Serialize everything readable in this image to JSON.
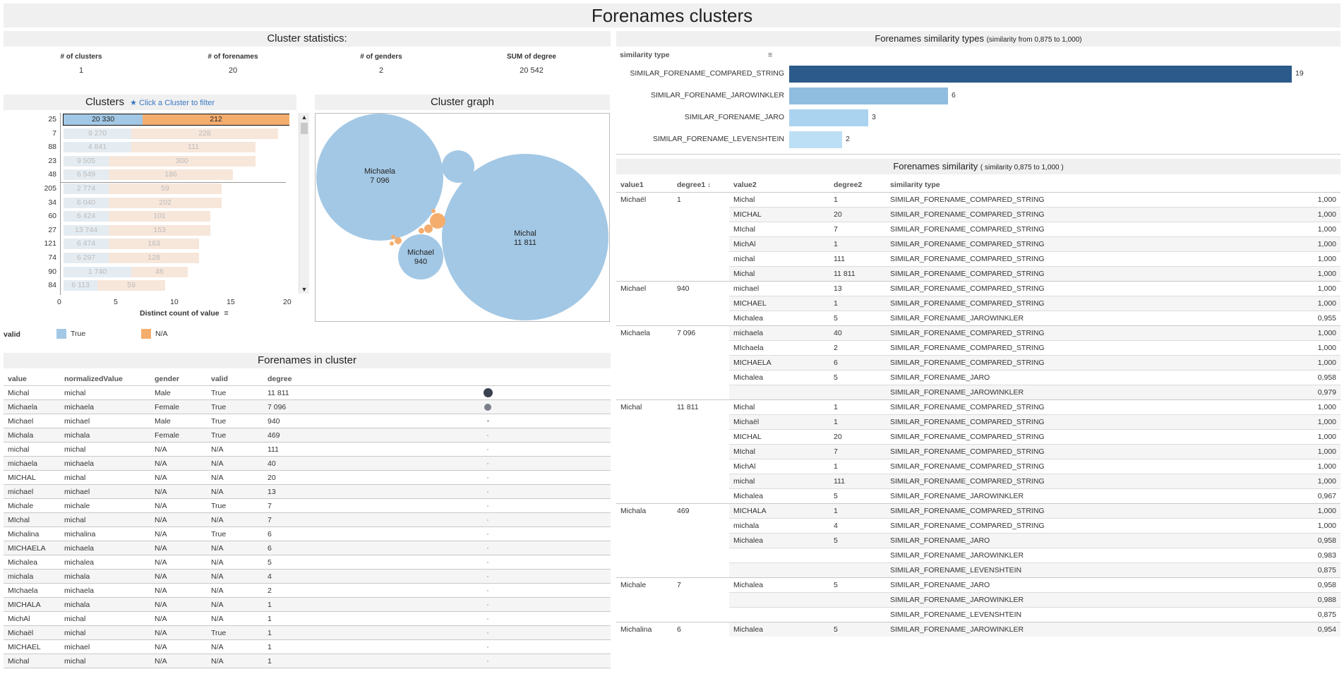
{
  "title": "Forenames clusters",
  "stats": {
    "title": "Cluster statistics:",
    "items": [
      {
        "label": "# of clusters",
        "value": "1"
      },
      {
        "label": "# of forenames",
        "value": "20"
      },
      {
        "label": "# of genders",
        "value": "2"
      },
      {
        "label": "SUM of degree",
        "value": "20 542"
      }
    ]
  },
  "clusters": {
    "title": "Clusters",
    "hint": "★ Click a Cluster to filter",
    "axis_label": "Distinct count of value",
    "ticks": [
      "0",
      "5",
      "10",
      "15",
      "20"
    ],
    "legend_title": "valid",
    "legend": [
      {
        "label": "True",
        "color": "#a3c8e5"
      },
      {
        "label": "N/A",
        "color": "#f5ad6e"
      }
    ],
    "rows": [
      {
        "id": "25",
        "true": 7,
        "na": 13,
        "true_label": "20 330",
        "na_label": "212",
        "selected": true
      },
      {
        "id": "7",
        "true": 6,
        "na": 13,
        "true_label": "9 270",
        "na_label": "228"
      },
      {
        "id": "88",
        "true": 6,
        "na": 11,
        "true_label": "4 841",
        "na_label": "111"
      },
      {
        "id": "23",
        "true": 4,
        "na": 13,
        "true_label": "9 505",
        "na_label": "300"
      },
      {
        "id": "48",
        "true": 4,
        "na": 11,
        "true_label": "6 549",
        "na_label": "186"
      },
      {
        "id": "205",
        "true": 4,
        "na": 10,
        "true_label": "2 774",
        "na_label": "59"
      },
      {
        "id": "34",
        "true": 4,
        "na": 10,
        "true_label": "6 040",
        "na_label": "202"
      },
      {
        "id": "60",
        "true": 4,
        "na": 9,
        "true_label": "6 424",
        "na_label": "101"
      },
      {
        "id": "27",
        "true": 4,
        "na": 9,
        "true_label": "13 744",
        "na_label": "153"
      },
      {
        "id": "121",
        "true": 4,
        "na": 8,
        "true_label": "6 474",
        "na_label": "163"
      },
      {
        "id": "74",
        "true": 4,
        "na": 8,
        "true_label": "6 297",
        "na_label": "128"
      },
      {
        "id": "90",
        "true": 6,
        "na": 5,
        "true_label": "1 740",
        "na_label": "46"
      },
      {
        "id": "84",
        "true": 3,
        "na": 6,
        "true_label": "6 113",
        "na_label": "59"
      }
    ]
  },
  "graph": {
    "title": "Cluster graph",
    "bubbles": [
      {
        "name": "Michaela",
        "degree": "7 096"
      },
      {
        "name": "Michal",
        "degree": "11 811"
      },
      {
        "name": "Michael",
        "degree": "940"
      }
    ]
  },
  "forenames": {
    "title": "Forenames in cluster",
    "columns": [
      "value",
      "normalizedValue",
      "gender",
      "valid",
      "degree"
    ],
    "rows": [
      [
        "Michal",
        "michal",
        "Male",
        "True",
        "11 811"
      ],
      [
        "Michaela",
        "michaela",
        "Female",
        "True",
        "7 096"
      ],
      [
        "Michael",
        "michael",
        "Male",
        "True",
        "940"
      ],
      [
        "Michala",
        "michala",
        "Female",
        "True",
        "469"
      ],
      [
        "michal",
        "michal",
        "N/A",
        "N/A",
        "111"
      ],
      [
        "michaela",
        "michaela",
        "N/A",
        "N/A",
        "40"
      ],
      [
        "MICHAL",
        "michal",
        "N/A",
        "N/A",
        "20"
      ],
      [
        "michael",
        "michael",
        "N/A",
        "N/A",
        "13"
      ],
      [
        "Michale",
        "michale",
        "N/A",
        "True",
        "7"
      ],
      [
        "MIchal",
        "michal",
        "N/A",
        "N/A",
        "7"
      ],
      [
        "Michalina",
        "michalina",
        "N/A",
        "True",
        "6"
      ],
      [
        "MICHAELA",
        "michaela",
        "N/A",
        "N/A",
        "6"
      ],
      [
        "Michalea",
        "michalea",
        "N/A",
        "N/A",
        "5"
      ],
      [
        "michala",
        "michala",
        "N/A",
        "N/A",
        "4"
      ],
      [
        "MIchaela",
        "michaela",
        "N/A",
        "N/A",
        "2"
      ],
      [
        "MICHALA",
        "michala",
        "N/A",
        "N/A",
        "1"
      ],
      [
        "MichAl",
        "michal",
        "N/A",
        "N/A",
        "1"
      ],
      [
        "Michaël",
        "michal",
        "N/A",
        "True",
        "1"
      ],
      [
        "MICHAEL",
        "michael",
        "N/A",
        "N/A",
        "1"
      ],
      [
        "Michal",
        "michal",
        "N/A",
        "N/A",
        "1"
      ]
    ]
  },
  "simtypes": {
    "title": "Forenames similarity types",
    "subtitle": "(similarity from 0,875 to 1,000)",
    "column": "similarity type",
    "rows": [
      {
        "label": "SIMILAR_FORENAME_COMPARED_STRING",
        "value": 19,
        "color": "#2c5a8a"
      },
      {
        "label": "SIMILAR_FORENAME_JAROWINKLER",
        "value": 6,
        "color": "#8fbde0"
      },
      {
        "label": "SIMILAR_FORENAME_JARO",
        "value": 3,
        "color": "#aad3ef"
      },
      {
        "label": "SIMILAR_FORENAME_LEVENSHTEIN",
        "value": 2,
        "color": "#bddff5"
      }
    ]
  },
  "similarity": {
    "title": "Forenames similarity",
    "subtitle": "( similarity 0,875 to 1,000 )",
    "columns": [
      "value1",
      "degree1",
      "value2",
      "degree2",
      "similarity type"
    ],
    "rows": [
      [
        "Michaël",
        "1",
        "Michal",
        "1",
        "SIMILAR_FORENAME_COMPARED_STRING",
        "1,000"
      ],
      [
        "",
        "",
        "MICHAL",
        "20",
        "SIMILAR_FORENAME_COMPARED_STRING",
        "1,000"
      ],
      [
        "",
        "",
        "MIchal",
        "7",
        "SIMILAR_FORENAME_COMPARED_STRING",
        "1,000"
      ],
      [
        "",
        "",
        "MichAl",
        "1",
        "SIMILAR_FORENAME_COMPARED_STRING",
        "1,000"
      ],
      [
        "",
        "",
        "michal",
        "111",
        "SIMILAR_FORENAME_COMPARED_STRING",
        "1,000"
      ],
      [
        "",
        "",
        "Michal",
        "11 811",
        "SIMILAR_FORENAME_COMPARED_STRING",
        "1,000"
      ],
      [
        "Michael",
        "940",
        "michael",
        "13",
        "SIMILAR_FORENAME_COMPARED_STRING",
        "1,000"
      ],
      [
        "",
        "",
        "MICHAEL",
        "1",
        "SIMILAR_FORENAME_COMPARED_STRING",
        "1,000"
      ],
      [
        "",
        "",
        "Michalea",
        "5",
        "SIMILAR_FORENAME_JAROWINKLER",
        "0,955"
      ],
      [
        "Michaela",
        "7 096",
        "michaela",
        "40",
        "SIMILAR_FORENAME_COMPARED_STRING",
        "1,000"
      ],
      [
        "",
        "",
        "MIchaela",
        "2",
        "SIMILAR_FORENAME_COMPARED_STRING",
        "1,000"
      ],
      [
        "",
        "",
        "MICHAELA",
        "6",
        "SIMILAR_FORENAME_COMPARED_STRING",
        "1,000"
      ],
      [
        "",
        "",
        "Michalea",
        "5",
        "SIMILAR_FORENAME_JARO",
        "0,958"
      ],
      [
        "",
        "",
        "",
        "",
        "SIMILAR_FORENAME_JAROWINKLER",
        "0,979"
      ],
      [
        "Michal",
        "11 811",
        "Michal",
        "1",
        "SIMILAR_FORENAME_COMPARED_STRING",
        "1,000"
      ],
      [
        "",
        "",
        "Michaël",
        "1",
        "SIMILAR_FORENAME_COMPARED_STRING",
        "1,000"
      ],
      [
        "",
        "",
        "MICHAL",
        "20",
        "SIMILAR_FORENAME_COMPARED_STRING",
        "1,000"
      ],
      [
        "",
        "",
        "MIchal",
        "7",
        "SIMILAR_FORENAME_COMPARED_STRING",
        "1,000"
      ],
      [
        "",
        "",
        "MichAl",
        "1",
        "SIMILAR_FORENAME_COMPARED_STRING",
        "1,000"
      ],
      [
        "",
        "",
        "michal",
        "111",
        "SIMILAR_FORENAME_COMPARED_STRING",
        "1,000"
      ],
      [
        "",
        "",
        "Michalea",
        "5",
        "SIMILAR_FORENAME_JAROWINKLER",
        "0,967"
      ],
      [
        "Michala",
        "469",
        "MICHALA",
        "1",
        "SIMILAR_FORENAME_COMPARED_STRING",
        "1,000"
      ],
      [
        "",
        "",
        "michala",
        "4",
        "SIMILAR_FORENAME_COMPARED_STRING",
        "1,000"
      ],
      [
        "",
        "",
        "Michalea",
        "5",
        "SIMILAR_FORENAME_JARO",
        "0,958"
      ],
      [
        "",
        "",
        "",
        "",
        "SIMILAR_FORENAME_JAROWINKLER",
        "0,983"
      ],
      [
        "",
        "",
        "",
        "",
        "SIMILAR_FORENAME_LEVENSHTEIN",
        "0,875"
      ],
      [
        "Michale",
        "7",
        "Michalea",
        "5",
        "SIMILAR_FORENAME_JARO",
        "0,958"
      ],
      [
        "",
        "",
        "",
        "",
        "SIMILAR_FORENAME_JAROWINKLER",
        "0,988"
      ],
      [
        "",
        "",
        "",
        "",
        "SIMILAR_FORENAME_LEVENSHTEIN",
        "0,875"
      ],
      [
        "Michalina",
        "6",
        "Michalea",
        "5",
        "SIMILAR_FORENAME_JAROWINKLER",
        "0,954"
      ]
    ]
  }
}
